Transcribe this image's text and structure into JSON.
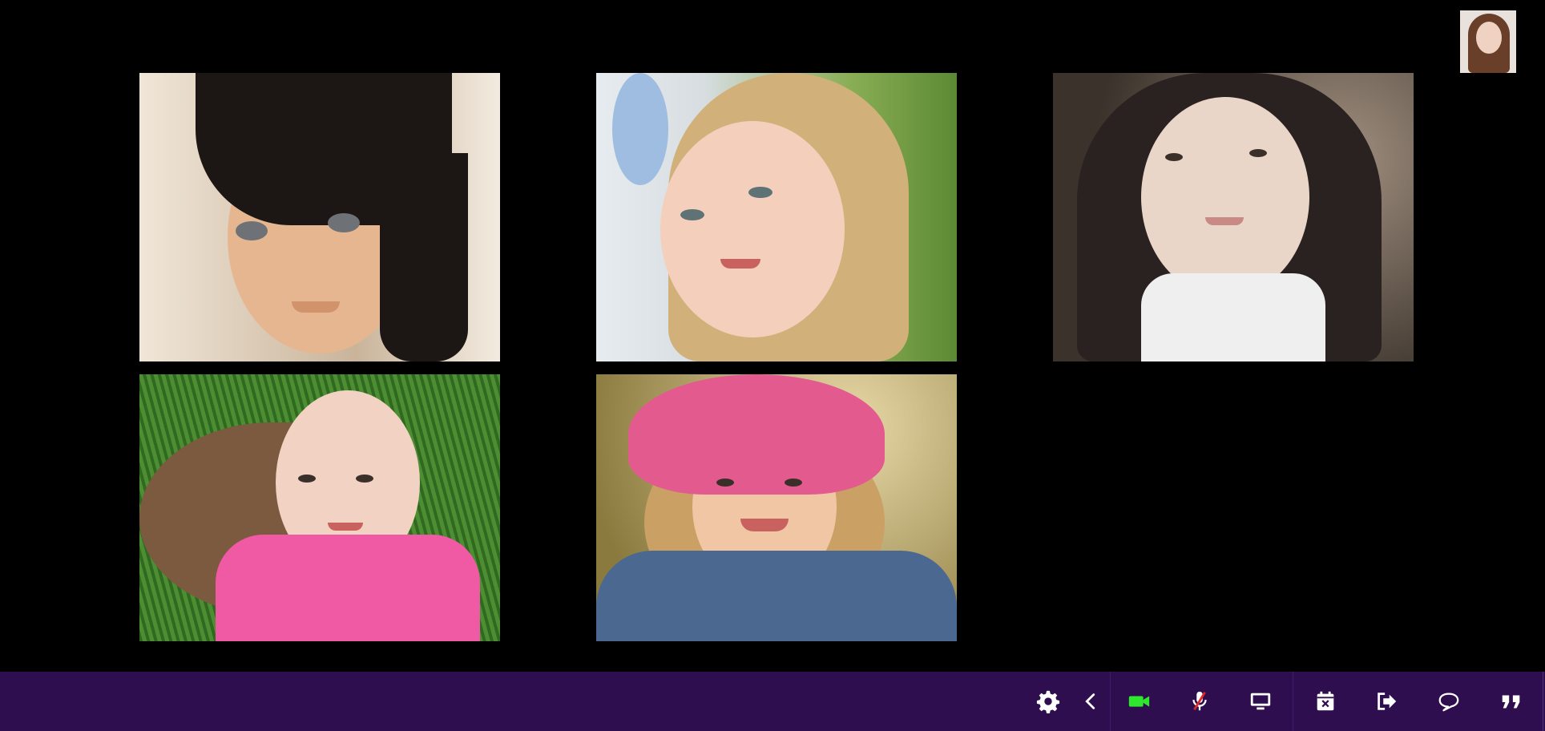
{
  "participants": [
    {
      "id": "p1",
      "kind": "video",
      "palette": {
        "bg": "#e8d9c4",
        "skin": "#e8b894",
        "hair": "#1c1714"
      }
    },
    {
      "id": "p2",
      "kind": "video",
      "palette": {
        "bg": "#7fa04a",
        "skin": "#f4d0bc",
        "hair": "#d2b07a"
      }
    },
    {
      "id": "p3",
      "kind": "video",
      "palette": {
        "bg": "#5a4e44",
        "skin": "#ead6c8",
        "hair": "#2a2220"
      }
    },
    {
      "id": "p4",
      "kind": "video",
      "palette": {
        "bg": "#3f7a2a",
        "skin": "#f2d2c2",
        "hair": "#7b5a40"
      }
    },
    {
      "id": "p5",
      "kind": "video",
      "palette": {
        "bg": "#c9b27a",
        "skin": "#f1c6a4",
        "hair": "#caa065"
      }
    }
  ],
  "self_view": {
    "palette": {
      "bg": "#e9e2dc",
      "skin": "#efd2c1",
      "hair": "#6a3f2a"
    }
  },
  "toolbar": {
    "background": "#2e0e4f",
    "icon_color": "#ffffff",
    "video_on_color": "#2ee82e",
    "mic_muted_color": "#e02828",
    "buttons": [
      {
        "name": "settings-icon"
      },
      {
        "name": "collapse-chevron-icon"
      },
      {
        "name": "camera-icon",
        "state": "on"
      },
      {
        "name": "microphone-muted-icon",
        "state": "muted"
      },
      {
        "name": "screen-share-icon"
      },
      {
        "name": "calendar-close-icon"
      },
      {
        "name": "leave-icon"
      },
      {
        "name": "chat-icon"
      },
      {
        "name": "quote-icon"
      }
    ]
  }
}
